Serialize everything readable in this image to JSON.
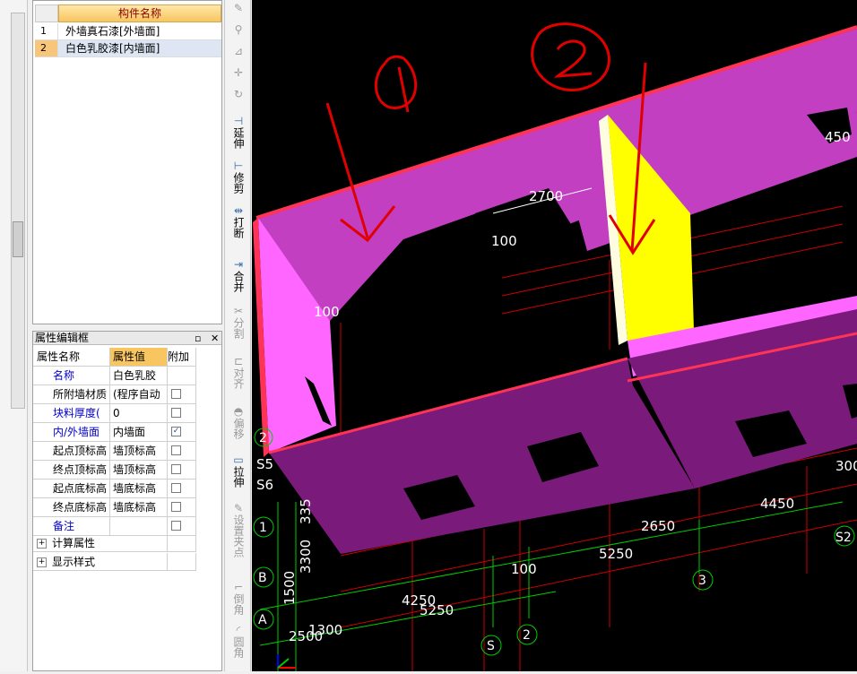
{
  "component_list": {
    "header": "构件名称",
    "rows": [
      {
        "num": "1",
        "name": "外墙真石漆[外墙面]"
      },
      {
        "num": "2",
        "name": "白色乳胶漆[内墙面]"
      }
    ]
  },
  "property_panel": {
    "title": "属性编辑框",
    "pin_icon": "pin-icon",
    "close_label": "✕",
    "headers": [
      "属性名称",
      "属性值",
      "附加"
    ],
    "rows": [
      {
        "name": "名称",
        "value": "白色乳胶",
        "blue": true,
        "checkbox": false,
        "checked": false
      },
      {
        "name": "所附墙材质",
        "value": "(程序自动",
        "blue": false,
        "checkbox": true,
        "checked": false
      },
      {
        "name": "块料厚度(",
        "value": "0",
        "blue": true,
        "checkbox": true,
        "checked": false
      },
      {
        "name": "内/外墙面",
        "value": "内墙面",
        "blue": true,
        "checkbox": true,
        "checked": true
      },
      {
        "name": "起点顶标高",
        "value": "墙顶标高",
        "blue": false,
        "checkbox": true,
        "checked": false
      },
      {
        "name": "终点顶标高",
        "value": "墙顶标高",
        "blue": false,
        "checkbox": true,
        "checked": false
      },
      {
        "name": "起点底标高",
        "value": "墙底标高",
        "blue": false,
        "checkbox": true,
        "checked": false
      },
      {
        "name": "终点底标高",
        "value": "墙底标高",
        "blue": false,
        "checkbox": true,
        "checked": false
      },
      {
        "name": "备注",
        "value": "",
        "blue": true,
        "checkbox": true,
        "checked": false
      }
    ],
    "groups": [
      "计算属性",
      "显示样式"
    ]
  },
  "toolbar": {
    "items": [
      {
        "icon": "✎",
        "label": "",
        "disabled": true
      },
      {
        "icon": "⚲",
        "label": "",
        "disabled": true
      },
      {
        "icon": "⊿",
        "label": "",
        "disabled": true
      },
      {
        "icon": "✛",
        "label": "",
        "disabled": true
      },
      {
        "icon": "↻",
        "label": "",
        "disabled": true
      },
      {
        "icon": "⊣",
        "label": "延伸",
        "disabled": false
      },
      {
        "icon": "⊢",
        "label": "修剪",
        "disabled": false
      },
      {
        "icon": "⇹",
        "label": "打断",
        "disabled": false
      },
      {
        "icon": "⇥",
        "label": "合并",
        "disabled": false
      },
      {
        "icon": "✂",
        "label": "分割",
        "disabled": true
      },
      {
        "icon": "⊏",
        "label": "对齐",
        "disabled": true
      },
      {
        "icon": "◓",
        "label": "偏移",
        "disabled": true
      },
      {
        "icon": "▭",
        "label": "拉伸",
        "disabled": false
      },
      {
        "icon": "✎",
        "label": "设置夹点",
        "disabled": true
      },
      {
        "icon": "⌐",
        "label": "倒角",
        "disabled": true
      },
      {
        "icon": "◜",
        "label": "圆角",
        "disabled": true
      }
    ]
  },
  "viewport": {
    "annotations": [
      "①",
      "②"
    ],
    "dimension_labels": [
      "2700",
      "100",
      "100",
      "450",
      "4450",
      "2650",
      "5250",
      "100",
      "4250",
      "5250",
      "1300",
      "2500",
      "1500",
      "3300",
      "335",
      "300"
    ],
    "axis_labels": [
      "S5",
      "S6",
      "1",
      "B",
      "A",
      "3",
      "S",
      "2",
      "S2",
      "2"
    ],
    "colors": {
      "wall_top": "#c23fc2",
      "wall_side": "#7a1a7a",
      "wall_light": "#ff66ff",
      "selected_face": "#ffff00",
      "edge": "#ff3355",
      "grid": "#cc0000",
      "axis": "#00cc00",
      "background": "#000000"
    }
  }
}
